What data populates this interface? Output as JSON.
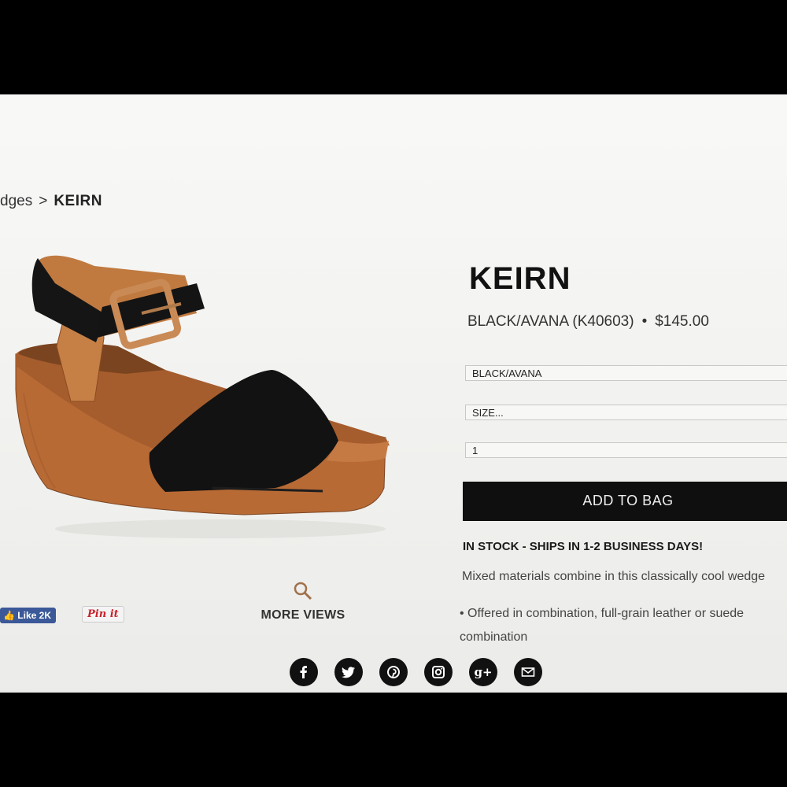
{
  "breadcrumb": {
    "parent": "dges",
    "separator": ">",
    "current": "KEIRN"
  },
  "product": {
    "name": "KEIRN",
    "color_code": "BLACK/AVANA (K40603)",
    "separator": "•",
    "price": "$145.00"
  },
  "form": {
    "color_value": "BLACK/AVANA",
    "size_value": "SIZE...",
    "quantity_value": "1",
    "add_to_bag_label": "ADD TO BAG"
  },
  "availability": "IN STOCK - SHIPS IN 1-2 BUSINESS DAYS!",
  "description": "Mixed materials combine in this classically cool wedge",
  "bullets": [
    "Offered in combination, full-grain leather or suede combination"
  ],
  "social_left": {
    "fb_like_label": "Like 2K",
    "pin_label": "Pin it"
  },
  "more_views_label": "MORE VIEWS",
  "share_icons": [
    "facebook-icon",
    "twitter-icon",
    "pinterest-icon",
    "instagram-icon",
    "google-plus-icon",
    "email-icon"
  ],
  "colors": {
    "black": "#0f0f0f",
    "tan": "#b8703e",
    "wedge": "#b86a35",
    "fb_blue": "#3b5998",
    "pin_red": "#c8232c"
  }
}
